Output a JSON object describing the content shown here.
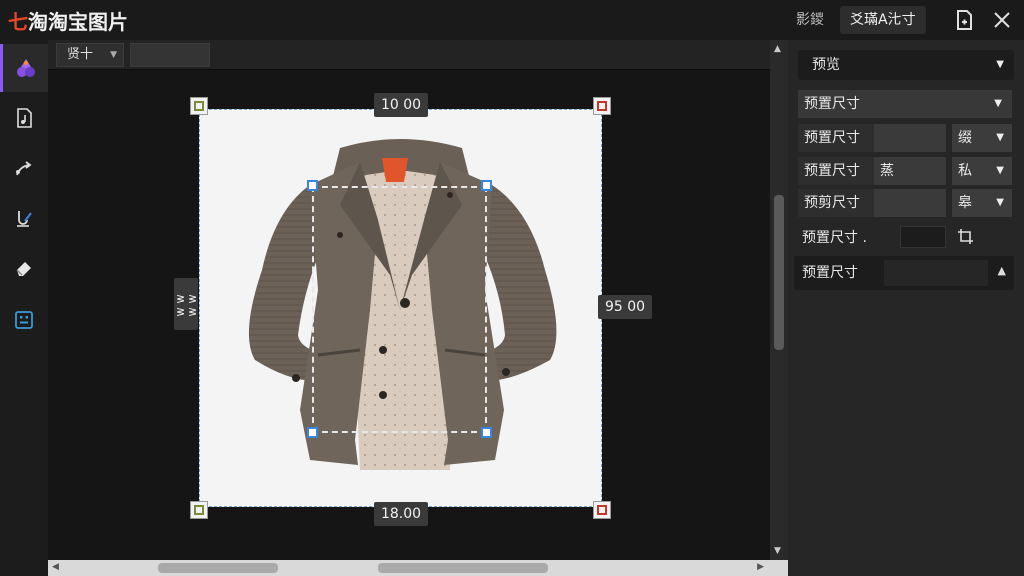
{
  "app": {
    "logo_mark": "七",
    "title": "淘淘宝图片"
  },
  "header": {
    "action_secondary": "影鑁",
    "action_primary": "爻璊A㲺寸",
    "save_icon": "file-save-icon",
    "close_icon": "close-icon"
  },
  "toolbar": {
    "tools": [
      "palette-icon",
      "document-audio-icon",
      "arrow-tool-icon",
      "brush-icon",
      "eraser-icon",
      "grid-select-icon"
    ]
  },
  "canvas": {
    "zoom_label": "贤十",
    "zoom_value": "",
    "dim_top": "10 00",
    "dim_right": "95 00",
    "dim_bottom": "18.00",
    "dim_left": "ᕒᕒ ᕒᕒ",
    "image_subject": "jacket-photo"
  },
  "panel": {
    "header": "预览",
    "rows": [
      {
        "label": "预置尺寸",
        "value": "",
        "option": ""
      },
      {
        "label": "预置尺寸",
        "value": "",
        "option": "缀"
      },
      {
        "label": "预置尺寸",
        "value": "蒸",
        "option": "私"
      },
      {
        "label": "预剪尺寸",
        "value": "",
        "option": "皋"
      },
      {
        "label": "预置尺寸 .",
        "value": "",
        "option": ""
      },
      {
        "label": "预置尺寸",
        "value": "",
        "option": ""
      }
    ]
  },
  "colors": {
    "accent": "#8a5cf6",
    "handle": "#3a86d8",
    "logo_accent": "#e8452b"
  }
}
